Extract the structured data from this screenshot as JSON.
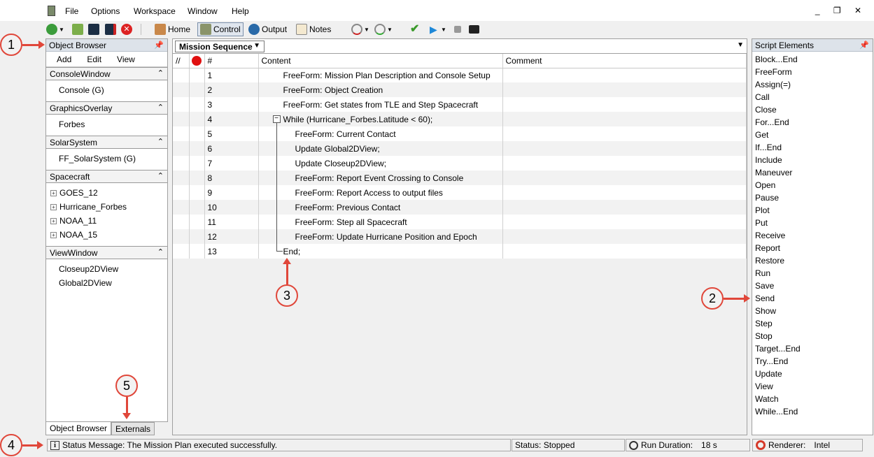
{
  "menubar": {
    "items": [
      "File",
      "Options",
      "Workspace",
      "Window",
      "Help"
    ],
    "window_controls": "_ ❐ ✕"
  },
  "toolbar": {
    "home_label": "Home",
    "control_label": "Control",
    "output_label": "Output",
    "notes_label": "Notes"
  },
  "object_browser": {
    "title": "Object Browser",
    "actions": [
      "Add",
      "Edit",
      "View"
    ],
    "groups": [
      {
        "name": "ConsoleWindow",
        "items": [
          "Console (G)"
        ]
      },
      {
        "name": "GraphicsOverlay",
        "items": [
          "Forbes"
        ]
      },
      {
        "name": "SolarSystem",
        "items": [
          "FF_SolarSystem (G)"
        ]
      },
      {
        "name": "Spacecraft",
        "items": [
          "GOES_12",
          "Hurricane_Forbes",
          "NOAA_11",
          "NOAA_15"
        ]
      },
      {
        "name": "ViewWindow",
        "items": [
          "Closeup2DView",
          "Global2DView"
        ]
      }
    ],
    "tabs": [
      "Object Browser",
      "Externals"
    ]
  },
  "mission": {
    "sequence_name": "Mission Sequence",
    "columns": {
      "disable": "//",
      "number": "#",
      "content": "Content",
      "comment": "Comment"
    },
    "rows": [
      {
        "num": "1",
        "content": "FreeForm: Mission Plan Description and Console Setup"
      },
      {
        "num": "2",
        "content": "FreeForm: Object Creation"
      },
      {
        "num": "3",
        "content": "FreeForm: Get states from TLE and Step Spacecraft"
      },
      {
        "num": "4",
        "content": "While (Hurricane_Forbes.Latitude < 60);"
      },
      {
        "num": "5",
        "content": "FreeForm: Current Contact"
      },
      {
        "num": "6",
        "content": "Update Global2DView;"
      },
      {
        "num": "7",
        "content": "Update Closeup2DView;"
      },
      {
        "num": "8",
        "content": "FreeForm: Report Event Crossing to Console"
      },
      {
        "num": "9",
        "content": "FreeForm: Report Access to output files"
      },
      {
        "num": "10",
        "content": "FreeForm: Previous Contact"
      },
      {
        "num": "11",
        "content": "FreeForm: Step all Spacecraft"
      },
      {
        "num": "12",
        "content": "FreeForm: Update Hurricane Position and Epoch"
      },
      {
        "num": "13",
        "content": "End;"
      }
    ]
  },
  "script_elements": {
    "title": "Script Elements",
    "items": [
      "Block...End",
      "FreeForm",
      "Assign(=)",
      "Call",
      "Close",
      "For...End",
      "Get",
      "If...End",
      "Include",
      "Maneuver",
      "Open",
      "Pause",
      "Plot",
      "Put",
      "Receive",
      "Report",
      "Restore",
      "Run",
      "Save",
      "Send",
      "Show",
      "Step",
      "Stop",
      "Target...End",
      "Try...End",
      "Update",
      "View",
      "Watch",
      "While...End"
    ]
  },
  "statusbar": {
    "message": "Status Message: The Mission Plan executed successfully.",
    "status": "Status: Stopped",
    "run_duration_label": "Run Duration:",
    "run_duration_value": "18 s",
    "renderer_label": "Renderer:",
    "renderer_value": "Intel"
  },
  "callouts": [
    "1",
    "2",
    "3",
    "4",
    "5"
  ],
  "colors": {
    "callout": "#e0473a",
    "breakpoint": "#e01010",
    "panel_header": "#dde3ea"
  }
}
